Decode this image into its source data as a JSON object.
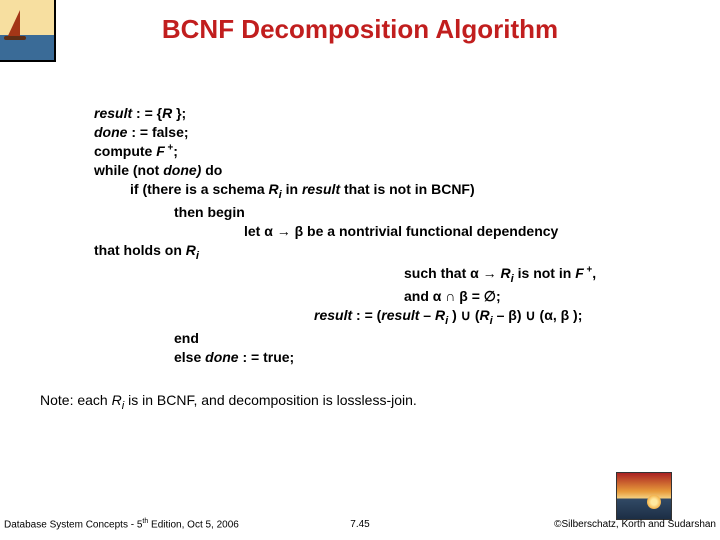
{
  "title": "BCNF Decomposition Algorithm",
  "algo": {
    "l1a_i": "result",
    "l1a_rest": " : = {",
    "l1a_R": "R",
    "l1a_end": " };",
    "l2a_i": "done",
    "l2a_rest": " : = false;",
    "l3": "compute ",
    "l3_F": "F",
    "l3_sup": " +",
    "l3_end": ";",
    "l4": "while (not ",
    "l4_i": "done)",
    "l4_end": " do",
    "l5": "if ",
    "l5_rest": "(there is a schema ",
    "l5_Ri": "R",
    "l5_i": "i",
    "l5_mid": " in ",
    "l5_result": "result",
    "l5_end": "  that is not in BCNF)",
    "l6": "then begin",
    "l7a": "let ",
    "l7_alpha": "α",
    "l7_arrow": "  →  ",
    "l7_beta": "β",
    "l7b": "  be a nontrivial functional dependency",
    "l7c": "that holds on ",
    "l7c_R": "R",
    "l7c_i": "i",
    "l8a": "such that ",
    "l8_alpha": "α",
    "l8_arrow": "  → ",
    "l8_R": "R",
    "l8_i": "i",
    "l8b": " is not in ",
    "l8_F": "F",
    "l8_sup": " +",
    "l8_end": ",",
    "l9a": "and ",
    "l9_alpha": "α",
    "l9_cap": " ∩ ",
    "l9_beta": "β",
    "l9b": "  = ∅;",
    "l10_a": "result",
    "l10_b": " : = (",
    "l10_c": "result",
    "l10_d": " – ",
    "l10_R": "R",
    "l10_i": "i",
    "l10_e": " ) ∪ (",
    "l10_R2": "R",
    "l10_i2": "i",
    "l10_f": " – ",
    "l10_beta": "β",
    "l10_g": ") ∪ (",
    "l10_alpha": "α",
    "l10_h": ", ",
    "l10_beta2": "β",
    "l10_j": " );",
    "l11": "end",
    "l12a": "else ",
    "l12_i": "done",
    "l12b": " : = true;"
  },
  "note": {
    "pre": "Note:  each ",
    "R": "R",
    "i": "i",
    "rest": " is in BCNF, and decomposition is lossless-join."
  },
  "footer": {
    "left_a": "Database System Concepts - 5",
    "left_sup": "th",
    "left_b": " Edition, Oct 5, 2006",
    "center": "7.45",
    "right": "©Silberschatz, Korth and Sudarshan"
  }
}
